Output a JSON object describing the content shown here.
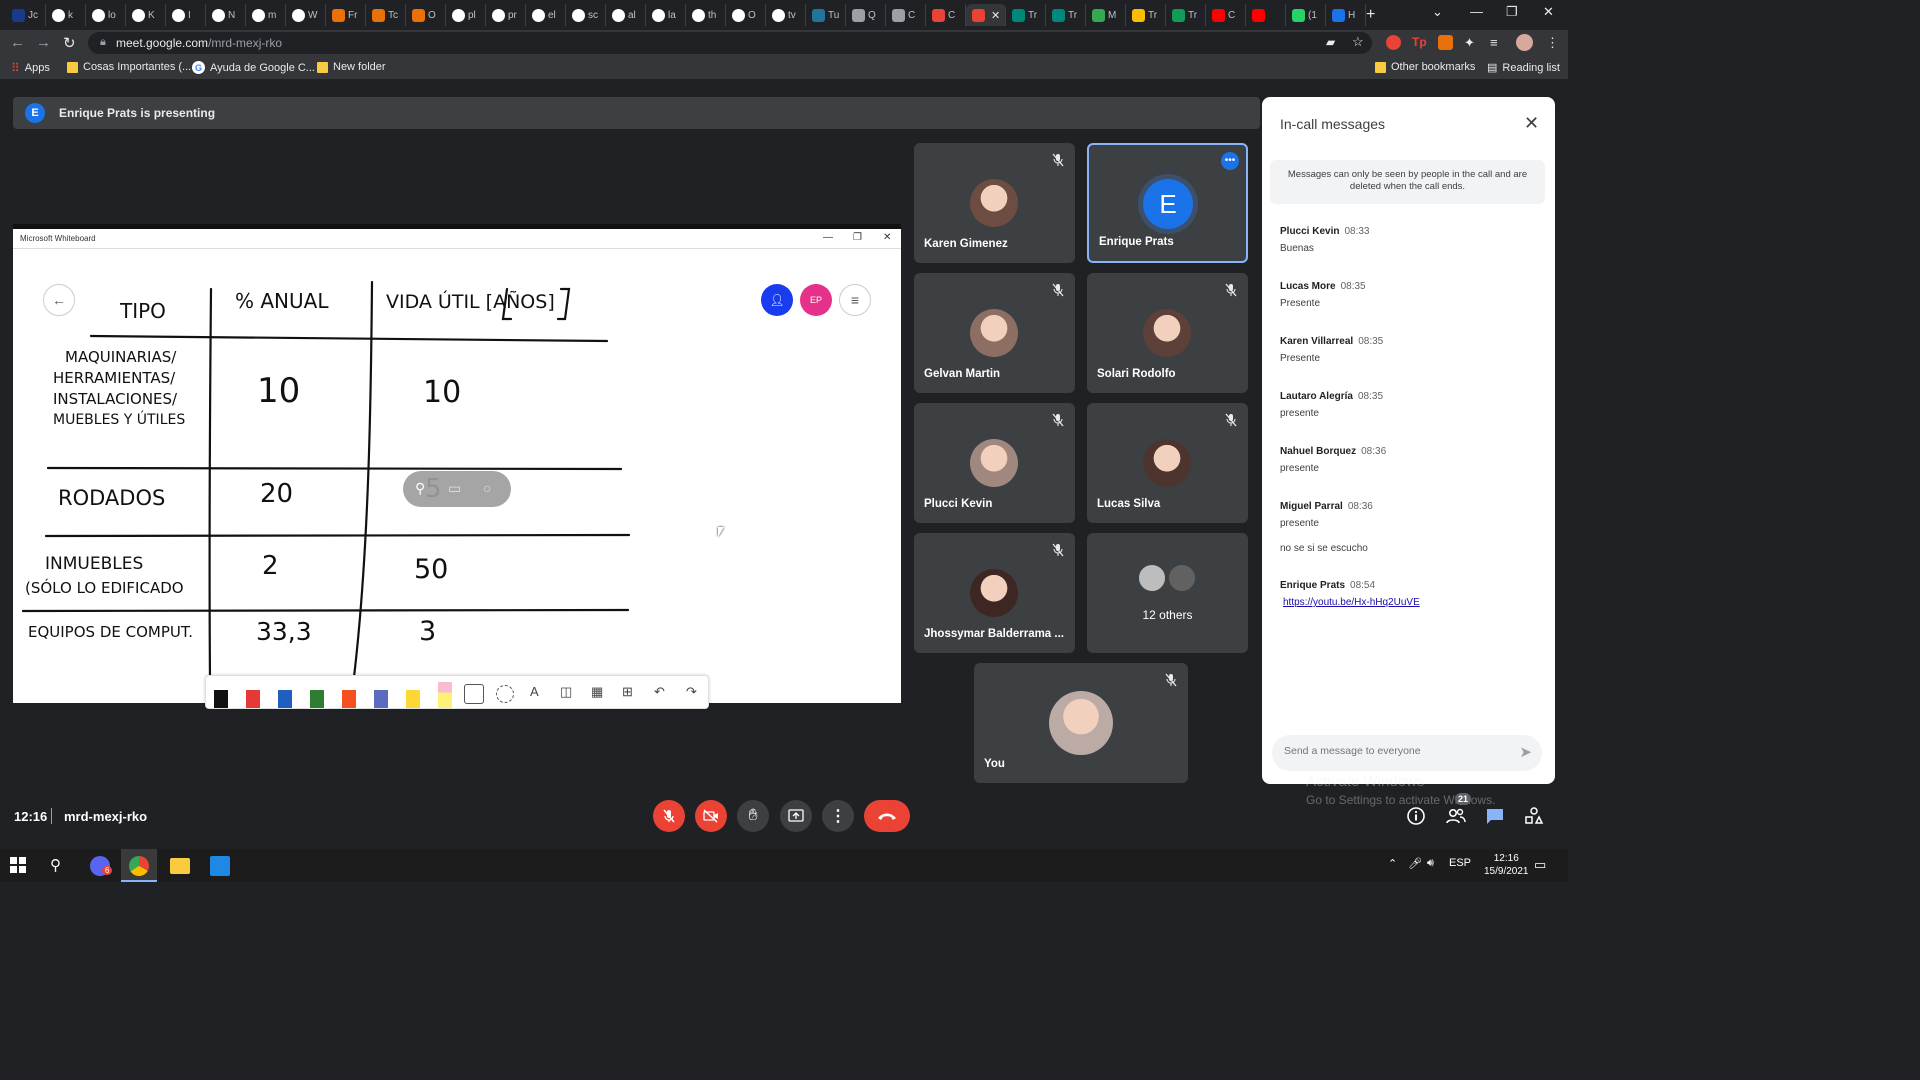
{
  "browser": {
    "tabs": [
      {
        "label": "Jc",
        "color": "#1a3a8c",
        "icon": "tab-favicon"
      },
      {
        "label": "k",
        "color": "#ffffff",
        "icon": "google-icon"
      },
      {
        "label": "lo",
        "color": "#ffffff",
        "icon": "google-icon"
      },
      {
        "label": "K",
        "color": "#ffffff",
        "icon": "google-icon"
      },
      {
        "label": "I",
        "color": "#ffffff",
        "icon": "google-icon"
      },
      {
        "label": "N",
        "color": "#ffffff",
        "icon": "google-icon"
      },
      {
        "label": "m",
        "color": "#ffffff",
        "icon": "google-icon"
      },
      {
        "label": "W",
        "color": "#ffffff",
        "icon": "google-icon"
      },
      {
        "label": "Fr",
        "color": "#e8710a",
        "icon": "tab-favicon"
      },
      {
        "label": "Tc",
        "color": "#e8710a",
        "icon": "tab-favicon"
      },
      {
        "label": "O",
        "color": "#e8710a",
        "icon": "tab-favicon"
      },
      {
        "label": "pl",
        "color": "#ffffff",
        "icon": "google-icon"
      },
      {
        "label": "pr",
        "color": "#ffffff",
        "icon": "google-icon"
      },
      {
        "label": "el",
        "color": "#ffffff",
        "icon": "google-icon"
      },
      {
        "label": "sc",
        "color": "#ffffff",
        "icon": "google-icon"
      },
      {
        "label": "al",
        "color": "#ffffff",
        "icon": "google-icon"
      },
      {
        "label": "la",
        "color": "#ffffff",
        "icon": "google-icon"
      },
      {
        "label": "th",
        "color": "#ffffff",
        "icon": "google-icon"
      },
      {
        "label": "O",
        "color": "#ffffff",
        "icon": "google-icon"
      },
      {
        "label": "tv",
        "color": "#ffffff",
        "icon": "google-icon"
      },
      {
        "label": "Tu",
        "color": "#21759b",
        "icon": "wordpress-icon"
      },
      {
        "label": "Q",
        "color": "#9aa0a6",
        "icon": "tab-favicon"
      },
      {
        "label": "C",
        "color": "#9aa0a6",
        "icon": "tab-favicon"
      },
      {
        "label": "C",
        "color": "#ea4335",
        "icon": "gmail-icon"
      },
      {
        "label": "",
        "color": "#ea4335",
        "icon": "meet-recording-icon"
      },
      {
        "label": "Tr",
        "color": "#00897b",
        "icon": "tab-favicon"
      },
      {
        "label": "Tr",
        "color": "#00897b",
        "icon": "tab-favicon"
      },
      {
        "label": "M",
        "color": "#34a853",
        "icon": "tab-favicon"
      },
      {
        "label": "Tr",
        "color": "#fbbc04",
        "icon": "drive-icon"
      },
      {
        "label": "Tr",
        "color": "#0f9d58",
        "icon": "sheets-icon"
      },
      {
        "label": "C",
        "color": "#ff0000",
        "icon": "youtube-icon"
      },
      {
        "label": "",
        "color": "#ff0000",
        "icon": "youtube-icon"
      },
      {
        "label": "(1",
        "color": "#25d366",
        "icon": "whatsapp-icon"
      },
      {
        "label": "H",
        "color": "#1a73e8",
        "icon": "tab-favicon"
      }
    ],
    "url_host": "meet.google.com",
    "url_path": "/mrd-mexj-rko",
    "bookmarks": [
      {
        "label": "Apps",
        "type": "apps"
      },
      {
        "label": "Cosas Importantes (...",
        "type": "folder"
      },
      {
        "label": "Ayuda de Google C...",
        "type": "google"
      },
      {
        "label": "New folder",
        "type": "folder"
      }
    ],
    "other_bookmarks": "Other bookmarks",
    "reading_list": "Reading list"
  },
  "meet": {
    "presenting_initial": "E",
    "presenting_text": "Enrique Prats is presenting",
    "whiteboard": {
      "window_title": "Microsoft Whiteboard",
      "presenter_initials": "EP",
      "table_headers": [
        "TIPO",
        "% ANUAL",
        "VIDA ÚTIL [AÑOS]"
      ],
      "rows": [
        {
          "tipo": [
            "MAQUINARIAS/",
            "HERRAMIENTAS/",
            "INSTALACIONES/",
            "MUEBLES Y ÚTILES"
          ],
          "anual": "10",
          "vida": "10"
        },
        {
          "tipo": [
            "RODADOS"
          ],
          "anual": "20",
          "vida": "5"
        },
        {
          "tipo": [
            "INMUEBLES",
            "(SÓLO LO EDIFICADO"
          ],
          "anual": "2",
          "vida": "50"
        },
        {
          "tipo": [
            "EQUIPOS DE COMPUT."
          ],
          "anual": "33,3",
          "vida": "3"
        }
      ]
    },
    "participants": [
      {
        "name": "Karen Gimenez",
        "photo": "#6d4c41",
        "muted": true
      },
      {
        "name": "Enrique Prats",
        "initial": "E",
        "selected": true
      },
      {
        "name": "Gelvan Martin",
        "photo": "#8d6e63",
        "muted": true
      },
      {
        "name": "Solari Rodolfo",
        "photo": "#5d4037",
        "muted": true
      },
      {
        "name": "Plucci Kevin",
        "photo": "#a1887f",
        "muted": true
      },
      {
        "name": "Lucas Silva",
        "photo": "#4e342e",
        "muted": true
      },
      {
        "name": "Jhossymar Balderrama ...",
        "photo": "#3e2723",
        "muted": true
      },
      {
        "name": "12 others",
        "others": true
      },
      {
        "name": "You",
        "photo": "#bcaaa4",
        "muted": true
      }
    ],
    "messages_panel": {
      "title": "In-call messages",
      "notice": "Messages can only be seen by people in the call and are deleted when the call ends.",
      "messages": [
        {
          "sender": "Plucci Kevin",
          "time": "08:33",
          "lines": [
            "Buenas"
          ]
        },
        {
          "sender": "Lucas More",
          "time": "08:35",
          "lines": [
            "Presente"
          ]
        },
        {
          "sender": "Karen Villarreal",
          "time": "08:35",
          "lines": [
            "Presente"
          ]
        },
        {
          "sender": "Lautaro Alegría",
          "time": "08:35",
          "lines": [
            "presente"
          ]
        },
        {
          "sender": "Nahuel Borquez",
          "time": "08:36",
          "lines": [
            "presente"
          ]
        },
        {
          "sender": "Miguel Parral",
          "time": "08:36",
          "lines": [
            "presente",
            "no se si se escucho"
          ]
        },
        {
          "sender": "Enrique Prats",
          "time": "08:54",
          "link": "https://youtu.be/Hx-hHq2UuVE"
        }
      ],
      "input_placeholder": "Send a message to everyone"
    },
    "clock": "12:16",
    "meeting_code": "mrd-mexj-rko",
    "people_count": "21",
    "accent": "#ea4335"
  },
  "windows": {
    "watermark_title": "Activate Windows",
    "watermark_sub": "Go to Settings to activate Windows.",
    "lang": "ESP",
    "time": "12:16",
    "date": "15/9/2021",
    "chrome_badge": "6"
  }
}
